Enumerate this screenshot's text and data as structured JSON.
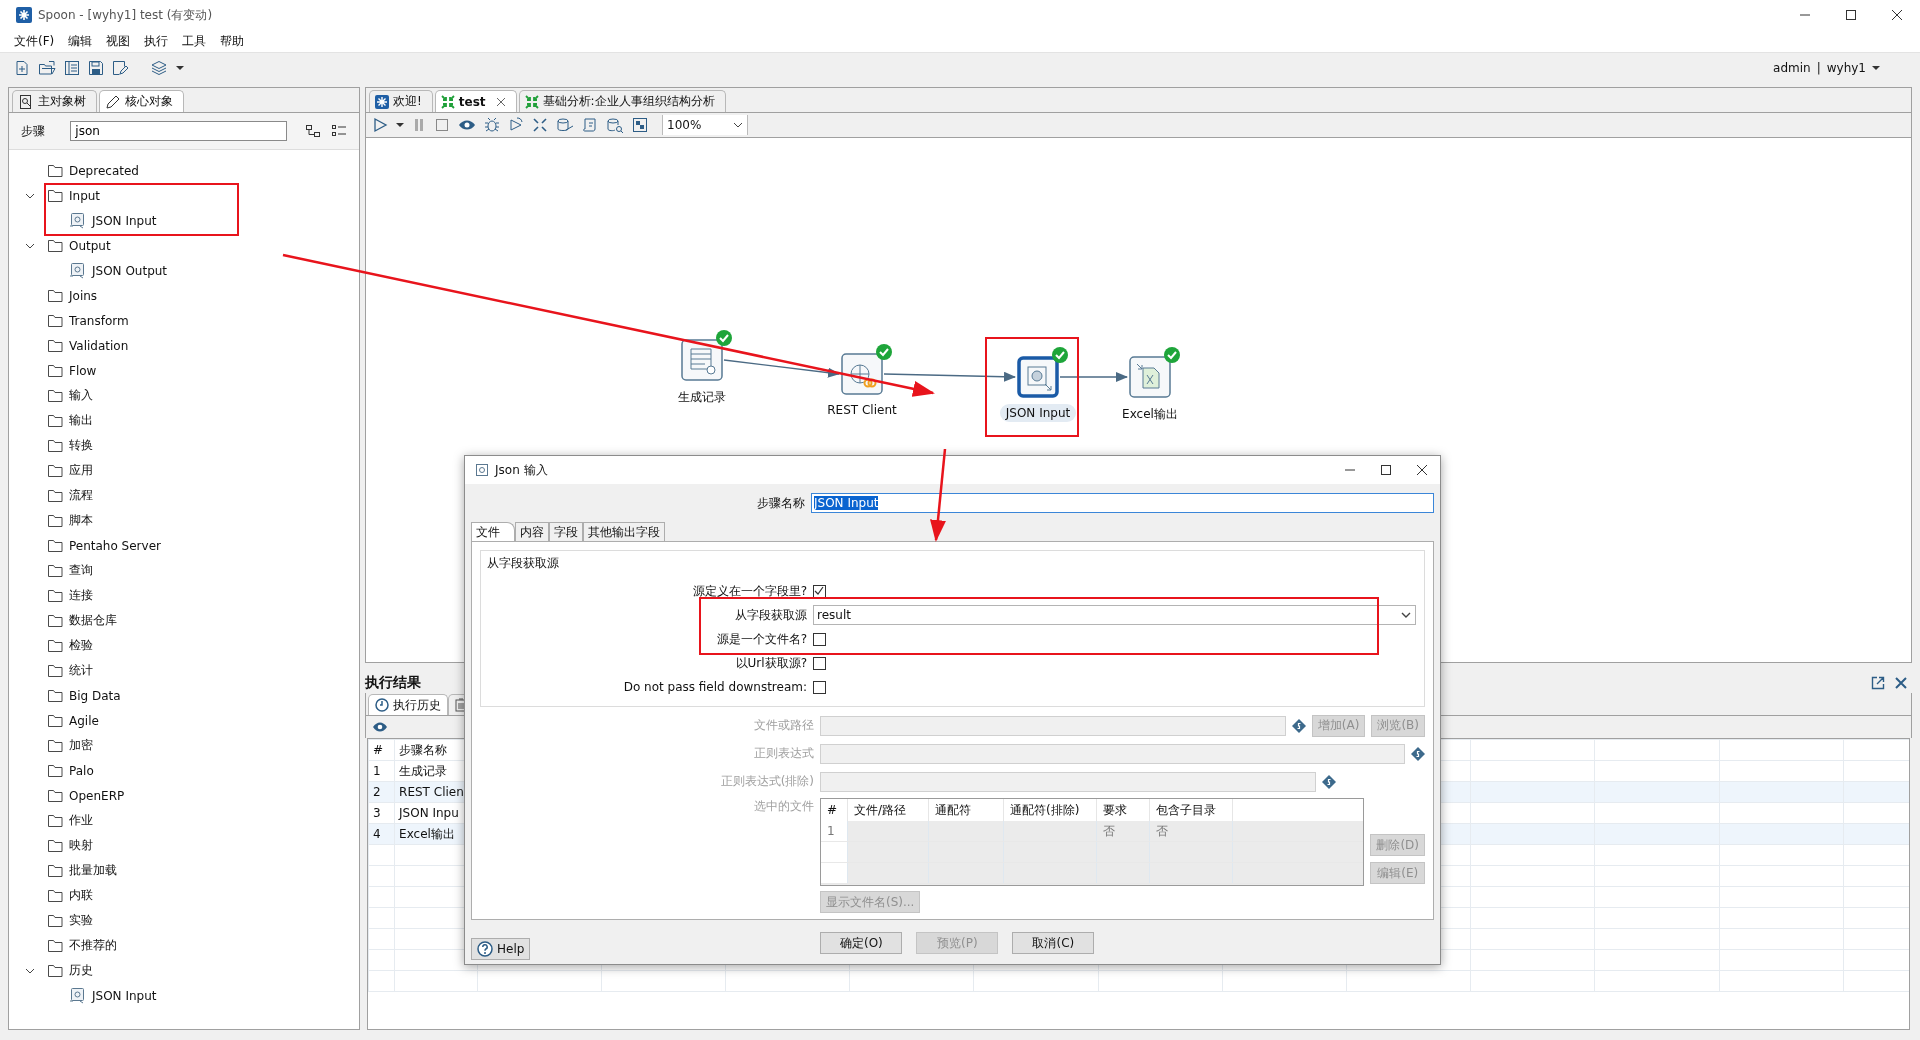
{
  "window": {
    "title": "Spoon - [wyhy1] test (有变动)"
  },
  "menu": [
    "文件(F)",
    "编辑",
    "视图",
    "执行",
    "工具",
    "帮助"
  ],
  "user": {
    "name": "admin",
    "separator": "|",
    "repository": "wyhy1"
  },
  "object_tabs": [
    {
      "label": "主对象树",
      "kind": "tree",
      "selected": false
    },
    {
      "label": "核心对象",
      "kind": "core",
      "selected": true
    }
  ],
  "step_search": {
    "label": "步骤",
    "value": "json"
  },
  "step_tree": [
    {
      "label": "Deprecated"
    },
    {
      "label": "Input",
      "expanded": true,
      "children": [
        {
          "label": "JSON Input"
        }
      ]
    },
    {
      "label": "Output",
      "expanded": true,
      "children": [
        {
          "label": "JSON Output"
        }
      ]
    },
    {
      "label": "Joins"
    },
    {
      "label": "Transform"
    },
    {
      "label": "Validation"
    },
    {
      "label": "Flow"
    },
    {
      "label": "输入"
    },
    {
      "label": "输出"
    },
    {
      "label": "转换"
    },
    {
      "label": "应用"
    },
    {
      "label": "流程"
    },
    {
      "label": "脚本"
    },
    {
      "label": "Pentaho Server"
    },
    {
      "label": "查询"
    },
    {
      "label": "连接"
    },
    {
      "label": "数据仓库"
    },
    {
      "label": "检验"
    },
    {
      "label": "统计"
    },
    {
      "label": "Big Data"
    },
    {
      "label": "Agile"
    },
    {
      "label": "加密"
    },
    {
      "label": "Palo"
    },
    {
      "label": "OpenERP"
    },
    {
      "label": "作业"
    },
    {
      "label": "映射"
    },
    {
      "label": "批量加载"
    },
    {
      "label": "内联"
    },
    {
      "label": "实验"
    },
    {
      "label": "不推荐的"
    },
    {
      "label": "历史",
      "expanded": true,
      "children": [
        {
          "label": "JSON Input"
        }
      ]
    }
  ],
  "editor_tabs": [
    {
      "label": "欢迎!",
      "kind": "welcome",
      "selected": false,
      "closable": false
    },
    {
      "label": "test",
      "kind": "transformation",
      "selected": true,
      "closable": true
    },
    {
      "label": "基础分析:企业人事组织结构分析",
      "kind": "transformation",
      "selected": false,
      "closable": false
    }
  ],
  "zoom": "100%",
  "canvas": {
    "steps": [
      {
        "label": "生成记录",
        "kind": "generate",
        "selected": false,
        "ok": true
      },
      {
        "label": "REST Client",
        "kind": "rest",
        "selected": false,
        "ok": true
      },
      {
        "label": "JSON Input",
        "kind": "json",
        "selected": true,
        "ok": true
      },
      {
        "label": "Excel输出",
        "kind": "excel",
        "selected": false,
        "ok": true
      }
    ],
    "hops": [
      {
        "kind": "hop"
      },
      {
        "kind": "hop"
      },
      {
        "kind": "hop"
      }
    ]
  },
  "execution_results": {
    "title": "执行结果",
    "tabs": [
      {
        "label": "执行历史",
        "kind": "history",
        "selected": true
      },
      {
        "kind": "log",
        "selected": false
      }
    ],
    "columns": [
      "#",
      "步骤名称"
    ],
    "rows": [
      {
        "number": "1",
        "step": "生成记录"
      },
      {
        "number": "2",
        "step": "REST Clien"
      },
      {
        "number": "3",
        "step": "JSON Inpu"
      },
      {
        "number": "4",
        "step": "Excel输出"
      }
    ]
  },
  "dialog": {
    "title": "Json 输入",
    "step_name_label": "步骤名称",
    "step_name": "JSON Input",
    "tabs": [
      {
        "label": "文件",
        "selected": true
      },
      {
        "label": "内容",
        "selected": false
      },
      {
        "label": "字段",
        "selected": false
      },
      {
        "label": "其他输出字段",
        "selected": false
      }
    ],
    "group": "从字段获取源",
    "options": [
      {
        "label": "源定义在一个字段里?",
        "kind": "checkbox",
        "checked": true
      },
      {
        "label": "从字段获取源",
        "kind": "dropdown",
        "value": "result"
      },
      {
        "label": "源是一个文件名?",
        "kind": "checkbox",
        "checked": false
      },
      {
        "label": "以Url获取源?",
        "kind": "checkbox",
        "checked": false
      },
      {
        "label": "Do not pass field downstream:",
        "kind": "checkbox",
        "checked": false
      }
    ],
    "file_fields": [
      {
        "label": "文件或路径",
        "disabled": true,
        "buttons": [
          {
            "label": "增加(A)",
            "disabled": true
          },
          {
            "label": "浏览(B)",
            "disabled": true
          }
        ]
      },
      {
        "label": "正则表达式",
        "disabled": true,
        "wide": true
      },
      {
        "label": "正则表达式(排除)",
        "disabled": true
      }
    ],
    "selected_files": {
      "label": "选中的文件",
      "columns": [
        "#",
        "文件/路径",
        "通配符",
        "通配符(排除)",
        "要求",
        "包含子目录"
      ],
      "rows": [
        {
          "number": "1",
          "required": "否",
          "include_subfolders": "否"
        }
      ],
      "buttons": [
        {
          "label": "删除(D)",
          "disabled": true
        },
        {
          "label": "编辑(E)",
          "disabled": true
        }
      ]
    },
    "show_filenames": {
      "label": "显示文件名(S)...",
      "disabled": true
    },
    "help": "Help",
    "buttons": [
      {
        "label": "确定(O)",
        "disabled": false
      },
      {
        "label": "预览(P)",
        "disabled": true
      },
      {
        "label": "取消(C)",
        "disabled": false
      }
    ]
  },
  "annotations": [
    {
      "kind": "box"
    },
    {
      "kind": "box"
    },
    {
      "kind": "box"
    },
    {
      "kind": "arrow"
    },
    {
      "kind": "arrow"
    }
  ]
}
